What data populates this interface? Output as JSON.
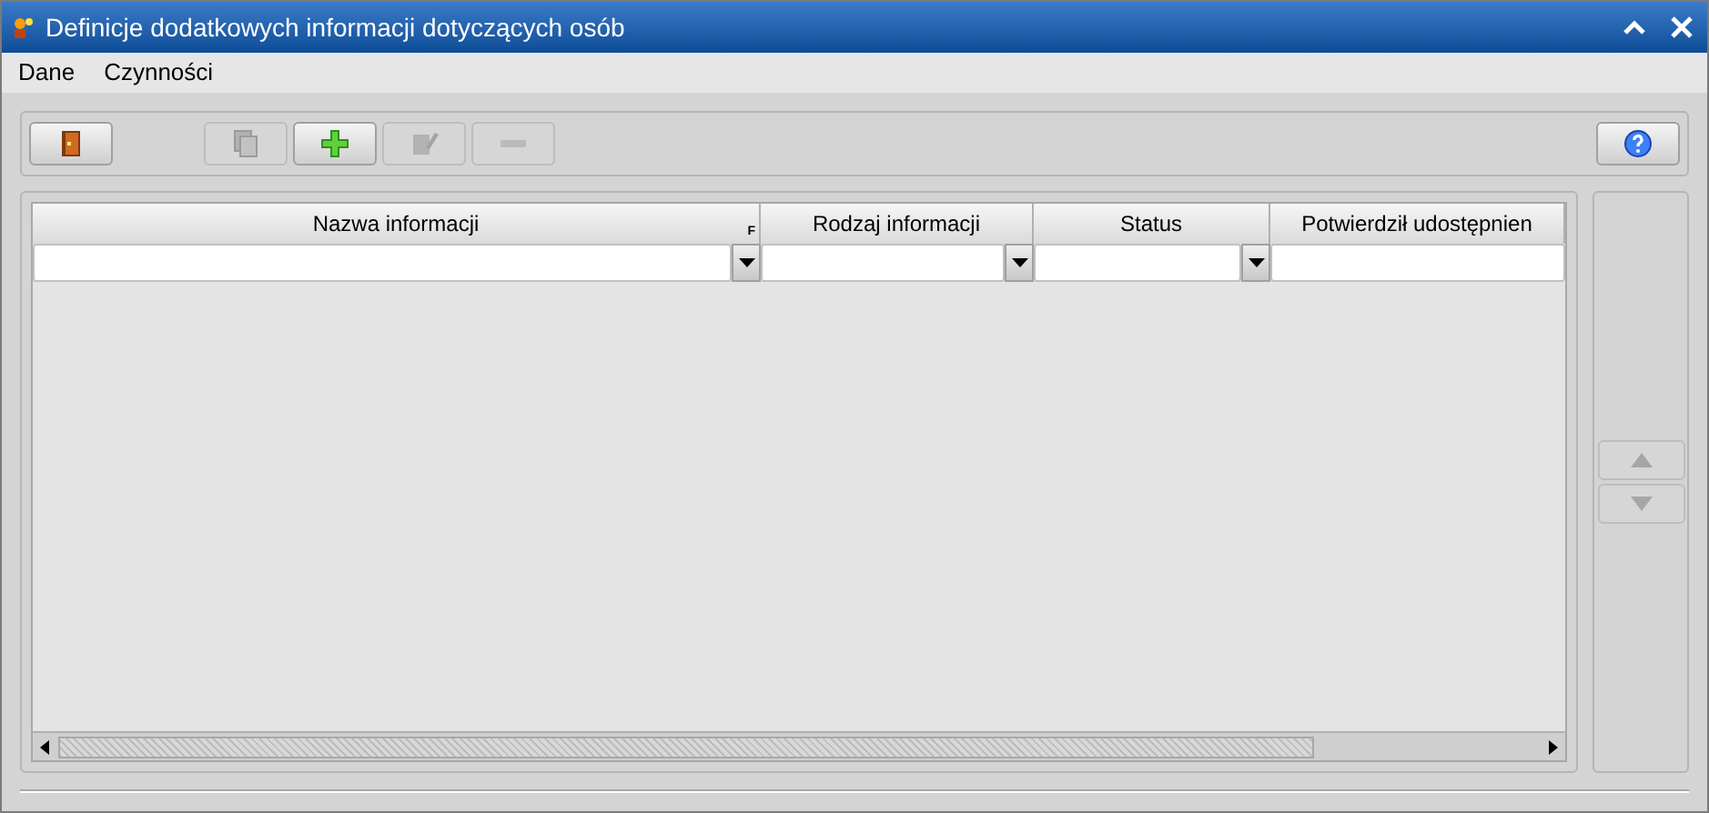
{
  "window": {
    "title": "Definicje dodatkowych informacji dotyczących osób"
  },
  "menu": [
    {
      "label": "Dane"
    },
    {
      "label": "Czynności"
    }
  ],
  "toolbar": [
    {
      "kind": "exit",
      "disabled": false
    },
    {
      "kind": "copy",
      "disabled": true
    },
    {
      "kind": "add",
      "disabled": false
    },
    {
      "kind": "edit",
      "disabled": true
    },
    {
      "kind": "remove",
      "disabled": true
    },
    {
      "kind": "help",
      "disabled": false
    }
  ],
  "table": {
    "columns": [
      {
        "label": "Nazwa informacji",
        "marker": "F"
      },
      {
        "label": "Rodzaj informacji"
      },
      {
        "label": "Status"
      },
      {
        "label": "Potwierdził udostępnien"
      }
    ]
  },
  "side_buttons": [
    {
      "kind": "up",
      "disabled": true
    },
    {
      "kind": "down",
      "disabled": true
    }
  ]
}
